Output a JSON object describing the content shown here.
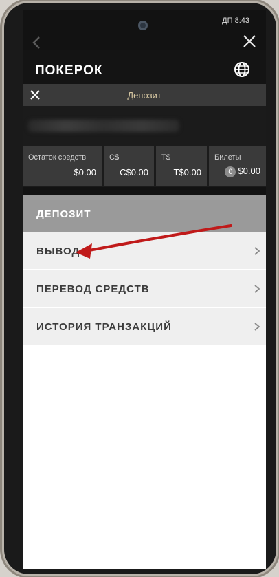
{
  "status_bar": {
    "time": "ДП 8:43"
  },
  "header": {
    "logo": "ПОКЕРОК"
  },
  "subheader": {
    "title": "Депозит"
  },
  "balances": [
    {
      "label": "Остаток средств",
      "value": "$0.00"
    },
    {
      "label": "C$",
      "value": "C$0.00"
    },
    {
      "label": "T$",
      "value": "T$0.00"
    },
    {
      "label": "Билеты",
      "badge": "0",
      "value": "$0.00"
    }
  ],
  "menu": {
    "active": "ДЕПОЗИТ",
    "items": [
      {
        "label": "ВЫВОД"
      },
      {
        "label": "ПЕРЕВОД СРЕДСТВ"
      },
      {
        "label": "ИСТОРИЯ ТРАНЗАКЦИЙ"
      }
    ]
  },
  "colors": {
    "annotation_arrow": "#c01a1a",
    "title_accent": "#d8c9a3"
  },
  "icons": [
    "back-icon",
    "close-icon",
    "globe-icon",
    "chevron-right-icon",
    "camera-icon"
  ]
}
